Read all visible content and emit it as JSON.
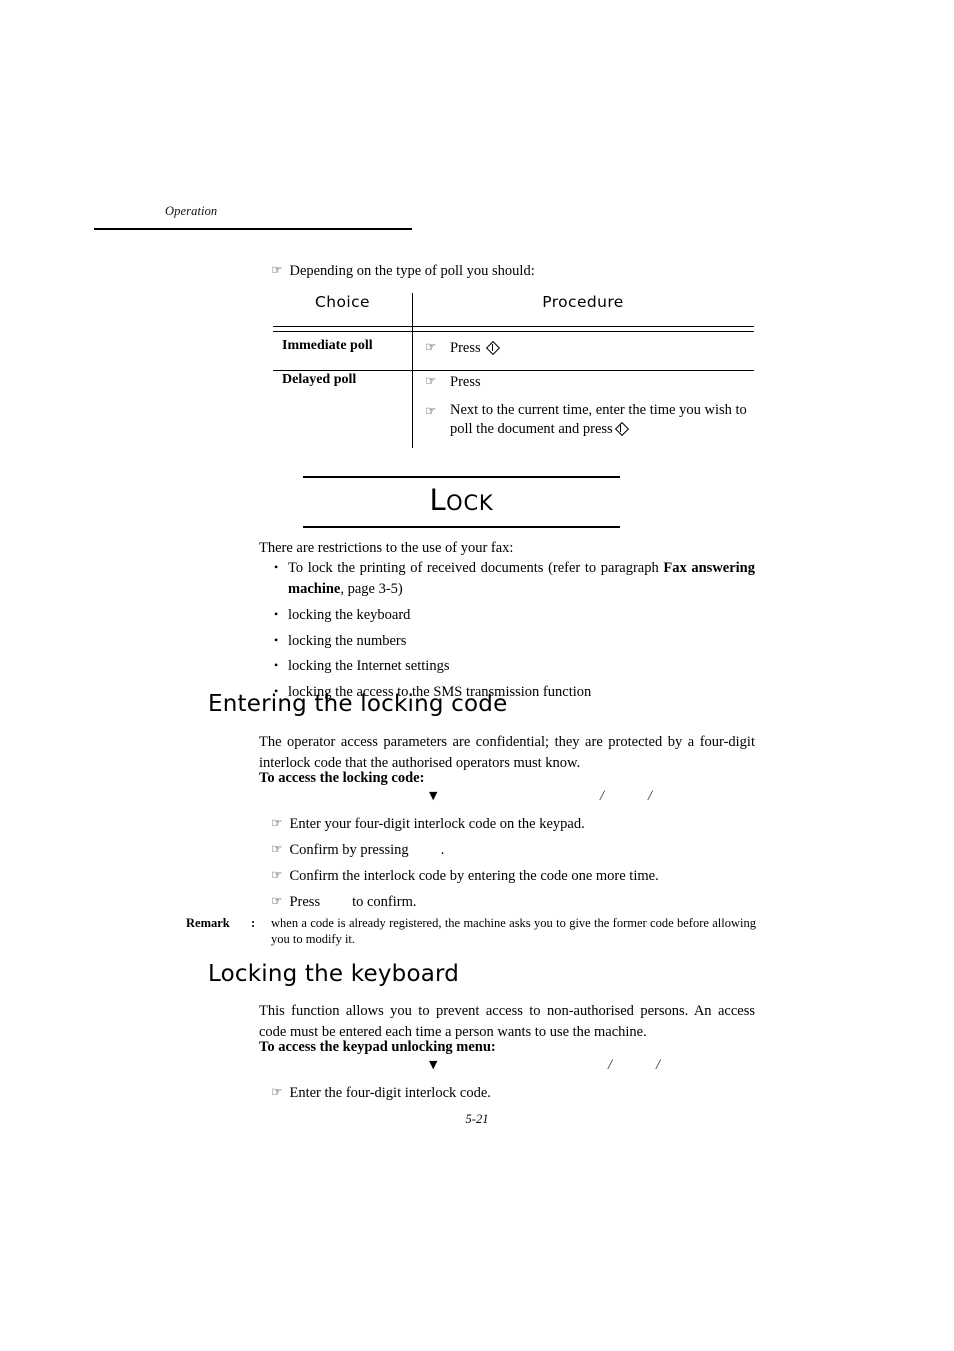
{
  "page": {
    "running_header": "Operation",
    "footer_page_number": "5-21"
  },
  "lead_in": {
    "marker": "pointing-hand-icon",
    "text": "Depending on the type of poll you should:"
  },
  "poll_table": {
    "headers": {
      "choice": "Choice",
      "procedure": "Procedure"
    },
    "rows": [
      {
        "choice": "Immediate poll",
        "steps": [
          {
            "text_before": "Press",
            "key": "diamond-key-icon",
            "text_after": ""
          }
        ]
      },
      {
        "choice": "Delayed poll",
        "steps": [
          {
            "text_before": "Press",
            "key": "",
            "text_after": ""
          },
          {
            "text_before": "Next to the current time, enter the time you wish to poll the document and press",
            "key": "diamond-key-icon",
            "text_after": ""
          }
        ]
      }
    ]
  },
  "chapter": {
    "title_first_letter": "L",
    "title_rest": "OCK"
  },
  "lock_intro": {
    "text": "There are restrictions to the use of your fax:",
    "bullets": [
      {
        "pre": "To lock the printing of received documents (refer to paragraph ",
        "bold": "Fax answering machine",
        "post": ", page 3-5)"
      },
      {
        "pre": "locking the keyboard",
        "bold": "",
        "post": ""
      },
      {
        "pre": "locking the numbers",
        "bold": "",
        "post": ""
      },
      {
        "pre": "locking the Internet settings",
        "bold": "",
        "post": ""
      },
      {
        "pre": "locking the access to the SMS transmission function",
        "bold": "",
        "post": ""
      }
    ]
  },
  "section_entering_code": {
    "heading": "Entering the locking code",
    "paragraph": "The operator access parameters are confidential; they are protected by a four-digit interlock code that the authorised operators must know.",
    "access_label": "To access the locking code:",
    "menu_path": {
      "marker": "down-triangle-icon",
      "separator_1": "/",
      "separator_2": "/",
      "item_1": "",
      "item_2": "",
      "item_3": ""
    },
    "steps": [
      {
        "marker": "pointing-hand-icon",
        "text_before": "Enter your four-digit interlock code on the keypad.",
        "has_key_gap": false,
        "text_after": ""
      },
      {
        "marker": "pointing-hand-icon",
        "text_before": "Confirm by pressing",
        "has_key_gap": true,
        "text_after": "."
      },
      {
        "marker": "pointing-hand-icon",
        "text_before": "Confirm the interlock code by entering the code one more time.",
        "has_key_gap": false,
        "text_after": ""
      },
      {
        "marker": "pointing-hand-icon",
        "text_before": "Press",
        "has_key_gap": true,
        "text_after": "to confirm."
      }
    ],
    "remark": {
      "label": "Remark",
      "colon": ":",
      "text": "when a code is already registered, the machine asks you to give the former code before allowing you to modify it."
    }
  },
  "section_locking_keyboard": {
    "heading": "Locking the keyboard",
    "paragraph": "This function allows you to prevent access to non-authorised persons. An access code must be entered each time a person wants to use the machine.",
    "access_label": "To access the keypad unlocking menu:",
    "menu_path": {
      "marker": "down-triangle-icon",
      "separator_1": "/",
      "separator_2": "/",
      "item_1": "",
      "item_2": "",
      "item_3": ""
    },
    "steps": [
      {
        "marker": "pointing-hand-icon",
        "text_before": "Enter the four-digit interlock code.",
        "has_key_gap": false,
        "text_after": ""
      }
    ]
  },
  "icons": {
    "pointing_hand": "☞",
    "down_triangle": "▼",
    "bullet": "•"
  }
}
